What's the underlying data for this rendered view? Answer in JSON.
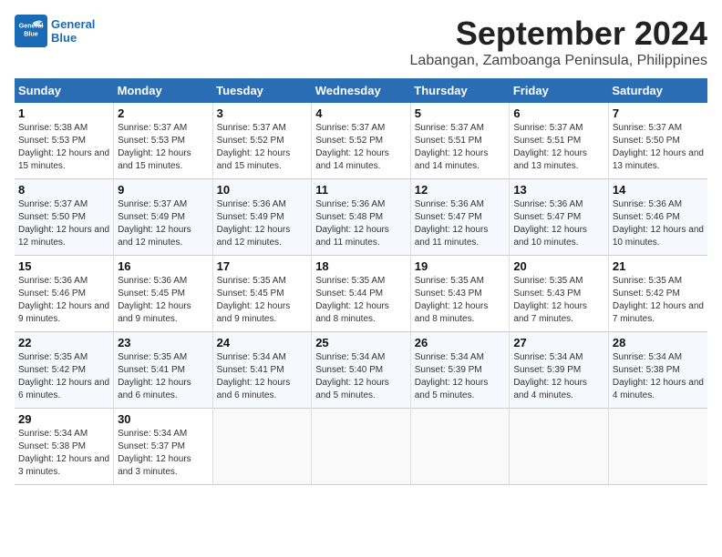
{
  "header": {
    "logo_line1": "General",
    "logo_line2": "Blue",
    "month_year": "September 2024",
    "location": "Labangan, Zamboanga Peninsula, Philippines"
  },
  "columns": [
    "Sunday",
    "Monday",
    "Tuesday",
    "Wednesday",
    "Thursday",
    "Friday",
    "Saturday"
  ],
  "weeks": [
    [
      {
        "day": "1",
        "sunrise": "Sunrise: 5:38 AM",
        "sunset": "Sunset: 5:53 PM",
        "daylight": "Daylight: 12 hours and 15 minutes."
      },
      {
        "day": "2",
        "sunrise": "Sunrise: 5:37 AM",
        "sunset": "Sunset: 5:53 PM",
        "daylight": "Daylight: 12 hours and 15 minutes."
      },
      {
        "day": "3",
        "sunrise": "Sunrise: 5:37 AM",
        "sunset": "Sunset: 5:52 PM",
        "daylight": "Daylight: 12 hours and 15 minutes."
      },
      {
        "day": "4",
        "sunrise": "Sunrise: 5:37 AM",
        "sunset": "Sunset: 5:52 PM",
        "daylight": "Daylight: 12 hours and 14 minutes."
      },
      {
        "day": "5",
        "sunrise": "Sunrise: 5:37 AM",
        "sunset": "Sunset: 5:51 PM",
        "daylight": "Daylight: 12 hours and 14 minutes."
      },
      {
        "day": "6",
        "sunrise": "Sunrise: 5:37 AM",
        "sunset": "Sunset: 5:51 PM",
        "daylight": "Daylight: 12 hours and 13 minutes."
      },
      {
        "day": "7",
        "sunrise": "Sunrise: 5:37 AM",
        "sunset": "Sunset: 5:50 PM",
        "daylight": "Daylight: 12 hours and 13 minutes."
      }
    ],
    [
      {
        "day": "8",
        "sunrise": "Sunrise: 5:37 AM",
        "sunset": "Sunset: 5:50 PM",
        "daylight": "Daylight: 12 hours and 12 minutes."
      },
      {
        "day": "9",
        "sunrise": "Sunrise: 5:37 AM",
        "sunset": "Sunset: 5:49 PM",
        "daylight": "Daylight: 12 hours and 12 minutes."
      },
      {
        "day": "10",
        "sunrise": "Sunrise: 5:36 AM",
        "sunset": "Sunset: 5:49 PM",
        "daylight": "Daylight: 12 hours and 12 minutes."
      },
      {
        "day": "11",
        "sunrise": "Sunrise: 5:36 AM",
        "sunset": "Sunset: 5:48 PM",
        "daylight": "Daylight: 12 hours and 11 minutes."
      },
      {
        "day": "12",
        "sunrise": "Sunrise: 5:36 AM",
        "sunset": "Sunset: 5:47 PM",
        "daylight": "Daylight: 12 hours and 11 minutes."
      },
      {
        "day": "13",
        "sunrise": "Sunrise: 5:36 AM",
        "sunset": "Sunset: 5:47 PM",
        "daylight": "Daylight: 12 hours and 10 minutes."
      },
      {
        "day": "14",
        "sunrise": "Sunrise: 5:36 AM",
        "sunset": "Sunset: 5:46 PM",
        "daylight": "Daylight: 12 hours and 10 minutes."
      }
    ],
    [
      {
        "day": "15",
        "sunrise": "Sunrise: 5:36 AM",
        "sunset": "Sunset: 5:46 PM",
        "daylight": "Daylight: 12 hours and 9 minutes."
      },
      {
        "day": "16",
        "sunrise": "Sunrise: 5:36 AM",
        "sunset": "Sunset: 5:45 PM",
        "daylight": "Daylight: 12 hours and 9 minutes."
      },
      {
        "day": "17",
        "sunrise": "Sunrise: 5:35 AM",
        "sunset": "Sunset: 5:45 PM",
        "daylight": "Daylight: 12 hours and 9 minutes."
      },
      {
        "day": "18",
        "sunrise": "Sunrise: 5:35 AM",
        "sunset": "Sunset: 5:44 PM",
        "daylight": "Daylight: 12 hours and 8 minutes."
      },
      {
        "day": "19",
        "sunrise": "Sunrise: 5:35 AM",
        "sunset": "Sunset: 5:43 PM",
        "daylight": "Daylight: 12 hours and 8 minutes."
      },
      {
        "day": "20",
        "sunrise": "Sunrise: 5:35 AM",
        "sunset": "Sunset: 5:43 PM",
        "daylight": "Daylight: 12 hours and 7 minutes."
      },
      {
        "day": "21",
        "sunrise": "Sunrise: 5:35 AM",
        "sunset": "Sunset: 5:42 PM",
        "daylight": "Daylight: 12 hours and 7 minutes."
      }
    ],
    [
      {
        "day": "22",
        "sunrise": "Sunrise: 5:35 AM",
        "sunset": "Sunset: 5:42 PM",
        "daylight": "Daylight: 12 hours and 6 minutes."
      },
      {
        "day": "23",
        "sunrise": "Sunrise: 5:35 AM",
        "sunset": "Sunset: 5:41 PM",
        "daylight": "Daylight: 12 hours and 6 minutes."
      },
      {
        "day": "24",
        "sunrise": "Sunrise: 5:34 AM",
        "sunset": "Sunset: 5:41 PM",
        "daylight": "Daylight: 12 hours and 6 minutes."
      },
      {
        "day": "25",
        "sunrise": "Sunrise: 5:34 AM",
        "sunset": "Sunset: 5:40 PM",
        "daylight": "Daylight: 12 hours and 5 minutes."
      },
      {
        "day": "26",
        "sunrise": "Sunrise: 5:34 AM",
        "sunset": "Sunset: 5:39 PM",
        "daylight": "Daylight: 12 hours and 5 minutes."
      },
      {
        "day": "27",
        "sunrise": "Sunrise: 5:34 AM",
        "sunset": "Sunset: 5:39 PM",
        "daylight": "Daylight: 12 hours and 4 minutes."
      },
      {
        "day": "28",
        "sunrise": "Sunrise: 5:34 AM",
        "sunset": "Sunset: 5:38 PM",
        "daylight": "Daylight: 12 hours and 4 minutes."
      }
    ],
    [
      {
        "day": "29",
        "sunrise": "Sunrise: 5:34 AM",
        "sunset": "Sunset: 5:38 PM",
        "daylight": "Daylight: 12 hours and 3 minutes."
      },
      {
        "day": "30",
        "sunrise": "Sunrise: 5:34 AM",
        "sunset": "Sunset: 5:37 PM",
        "daylight": "Daylight: 12 hours and 3 minutes."
      },
      null,
      null,
      null,
      null,
      null
    ]
  ]
}
